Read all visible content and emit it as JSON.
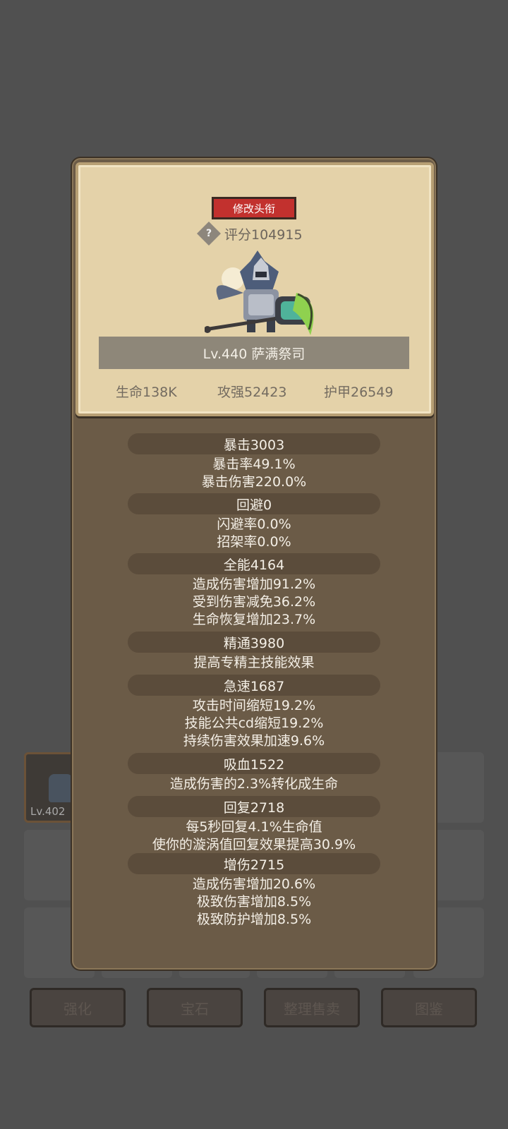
{
  "inventory": {
    "item_level": "Lv.402"
  },
  "bottom_buttons": [
    "强化",
    "宝石",
    "整理售卖",
    "图鉴"
  ],
  "overlay": {
    "change_title_button": "修改头衔",
    "help_icon": "question-mark",
    "help_glyph": "?",
    "score": "评分104915",
    "hero_name": "Lv.440 萨满祭司",
    "basic_stats": [
      "生命138K",
      "攻强52423",
      "护甲26549"
    ],
    "stat_groups": [
      {
        "header": "暴击3003",
        "lines": [
          "暴击率49.1%",
          "暴击伤害220.0%"
        ]
      },
      {
        "header": "回避0",
        "lines": [
          "闪避率0.0%",
          "招架率0.0%"
        ]
      },
      {
        "header": "全能4164",
        "lines": [
          "造成伤害增加91.2%",
          "受到伤害减免36.2%",
          "生命恢复增加23.7%"
        ]
      },
      {
        "header": "精通3980",
        "lines": [
          "提高专精主技能效果"
        ]
      },
      {
        "header": "急速1687",
        "lines": [
          "攻击时间缩短19.2%",
          "技能公共cd缩短19.2%",
          "持续伤害效果加速9.6%"
        ]
      },
      {
        "header": "吸血1522",
        "lines": [
          "造成伤害的2.3%转化成生命"
        ]
      },
      {
        "header": "回复2718",
        "lines": [
          "每5秒回复4.1%生命值",
          "使你的漩涡值回复效果提高30.9%"
        ]
      },
      {
        "header": "增伤2715",
        "lines": [
          "造成伤害增加20.6%",
          "极致伤害增加8.5%",
          "极致防护增加8.5%"
        ]
      }
    ]
  },
  "colors": {
    "backdrop": "#505050",
    "panel": "#6b5b47",
    "card": "#e4d2a9",
    "title_button": "#c2312e",
    "stat_pill": "#5b4c3b"
  }
}
